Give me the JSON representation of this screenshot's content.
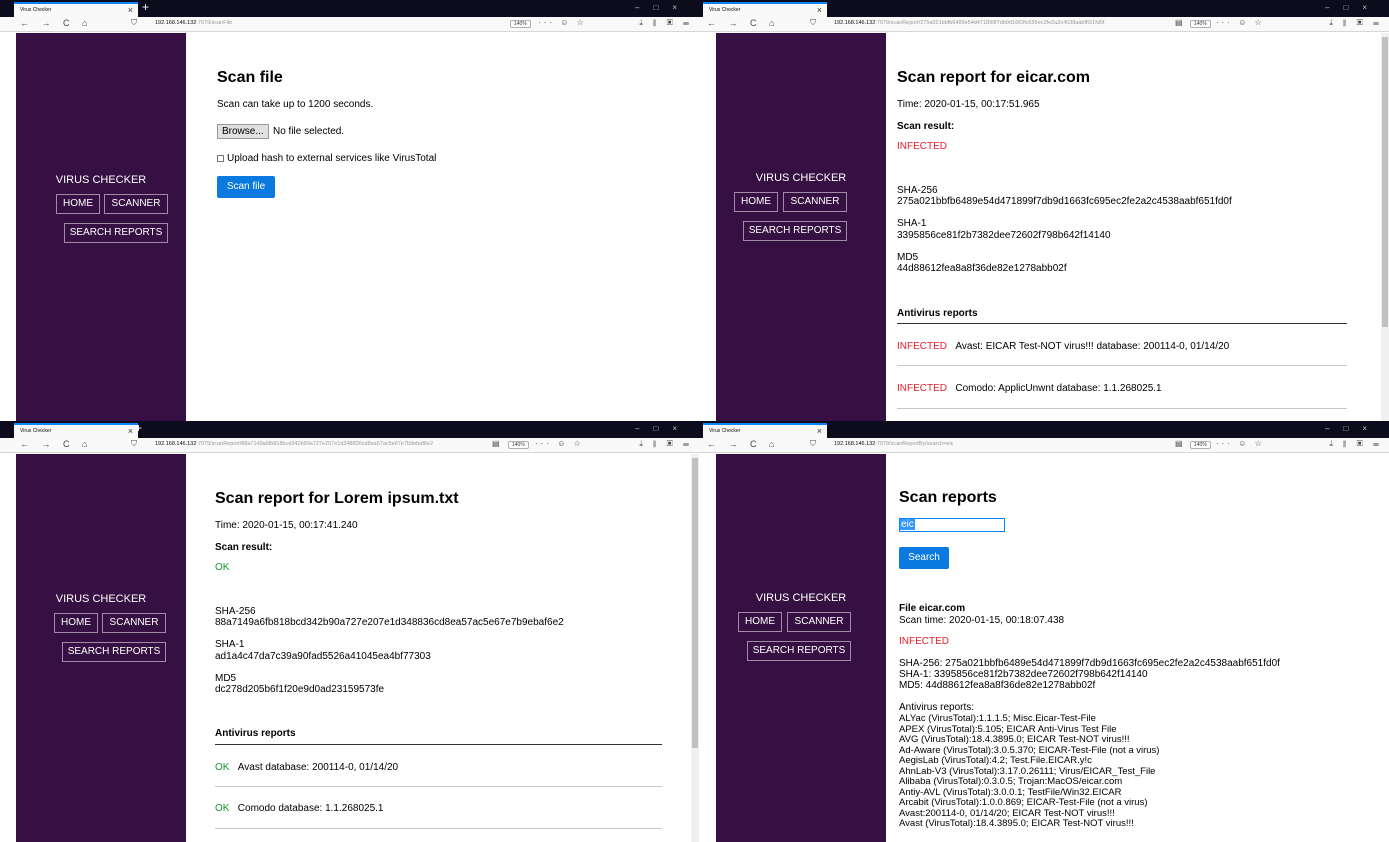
{
  "browser": {
    "tab_title": "Virus Checker",
    "tab_close": "×",
    "new_tab": "+",
    "window_controls": "–□×",
    "nav_buttons": "← → C ⌂",
    "shield": "⛉",
    "url_tools": "··· ☺ ☆",
    "right_tools": "⤓ ⫴ ▣ ☰",
    "reader_icon": "▤"
  },
  "app": {
    "brand": "VIRUS CHECKER",
    "home": "HOME",
    "scanner": "SCANNER",
    "search_reports": "SEARCH REPORTS"
  },
  "windows": {
    "scan_file": {
      "url_host": "192.168.146.132",
      "url_path": ":7979/scanFile",
      "zoom": "140%",
      "title": "Scan file",
      "note": "Scan can take up to 1200 seconds.",
      "browse": "Browse...",
      "no_file": "No file selected.",
      "upload_hash": "Upload hash to external services like VirusTotal",
      "scan_button": "Scan file"
    },
    "report_eicar": {
      "url_host": "192.168.146.132",
      "url_path": ":7979/scanReport/275a021bbfb6489e54d471899f7db9d1663fc695ec2fe2a2c4538aabf651fd0f",
      "zoom": "140%",
      "title": "Scan report for eicar.com",
      "time": "Time: 2020-01-15, 00:17:51.965",
      "scan_result_label": "Scan result:",
      "result": "INFECTED",
      "sha256_label": "SHA-256",
      "sha256": "275a021bbfb6489e54d471899f7db9d1663fc695ec2fe2a2c4538aabf651fd0f",
      "sha1_label": "SHA-1",
      "sha1": "3395856ce81f2b7382dee72602f798b642f14140",
      "md5_label": "MD5",
      "md5": "44d88612fea8a8f36de82e1278abb02f",
      "av_heading": "Antivirus reports",
      "av": [
        {
          "status": "INFECTED",
          "text": "Avast: EICAR Test-NOT virus!!!   database: 200114-0, 01/14/20"
        },
        {
          "status": "INFECTED",
          "text": "Comodo: ApplicUnwnt   database: 1.1.268025.1"
        }
      ]
    },
    "report_lorem": {
      "url_host": "192.168.146.132",
      "url_path": ":7979/scanReport/88a7149a6fb818bcd342b90a727e207e1d348836cd8ea57ac5e67e7b9ebaf6e2",
      "zoom": "140%",
      "title": "Scan report for Lorem ipsum.txt",
      "time": "Time: 2020-01-15, 00:17:41.240",
      "scan_result_label": "Scan result:",
      "result": "OK",
      "sha256_label": "SHA-256",
      "sha256": "88a7149a6fb818bcd342b90a727e207e1d348836cd8ea57ac5e67e7b9ebaf6e2",
      "sha1_label": "SHA-1",
      "sha1": "ad1a4c47da7c39a90fad5526a41045ea4bf77303",
      "md5_label": "MD5",
      "md5": "dc278d205b6f1f20e9d0ad23159573fe",
      "av_heading": "Antivirus reports",
      "av": [
        {
          "status": "OK",
          "text": "Avast   database: 200114-0, 01/14/20"
        },
        {
          "status": "OK",
          "text": "Comodo   database: 1.1.268025.1"
        }
      ]
    },
    "search": {
      "url_host": "192.168.146.132",
      "url_path": ":7979/scanReportBy/search=eic",
      "zoom": "140%",
      "title": "Scan reports",
      "query": "eic",
      "search_button": "Search",
      "file_label": "File eicar.com",
      "scan_time": "Scan time: 2020-01-15, 00:18:07.438",
      "result": "INFECTED",
      "sha256_line": "SHA-256: 275a021bbfb6489e54d471899f7db9d1663fc695ec2fe2a2c4538aabf651fd0f",
      "sha1_line": "SHA-1: 3395856ce81f2b7382dee72602f798b642f14140",
      "md5_line": "MD5: 44d88612fea8a8f36de82e1278abb02f",
      "av_heading": "Antivirus reports:",
      "av_lines": [
        "ALYac (VirusTotal):1.1.1.5; Misc.Eicar-Test-File",
        "APEX (VirusTotal):5.105; EICAR Anti-Virus Test File",
        "AVG (VirusTotal):18.4.3895.0; EICAR Test-NOT virus!!!",
        "Ad-Aware (VirusTotal):3.0.5.370; EICAR-Test-File (not a virus)",
        "AegisLab (VirusTotal):4.2; Test.File.EICAR.y!c",
        "AhnLab-V3 (VirusTotal):3.17.0.26111; Virus/EICAR_Test_File",
        "Alibaba (VirusTotal):0.3.0.5; Trojan:MacOS/eicar.com",
        "Antiy-AVL (VirusTotal):3.0.0.1; TestFile/Win32.EICAR",
        "Arcabit (VirusTotal):1.0.0.869; EICAR-Test-File (not a virus)",
        "Avast:200114-0, 01/14/20; EICAR Test-NOT virus!!!",
        "Avast (VirusTotal):18.4.3895.0; EICAR Test-NOT virus!!!"
      ]
    }
  }
}
